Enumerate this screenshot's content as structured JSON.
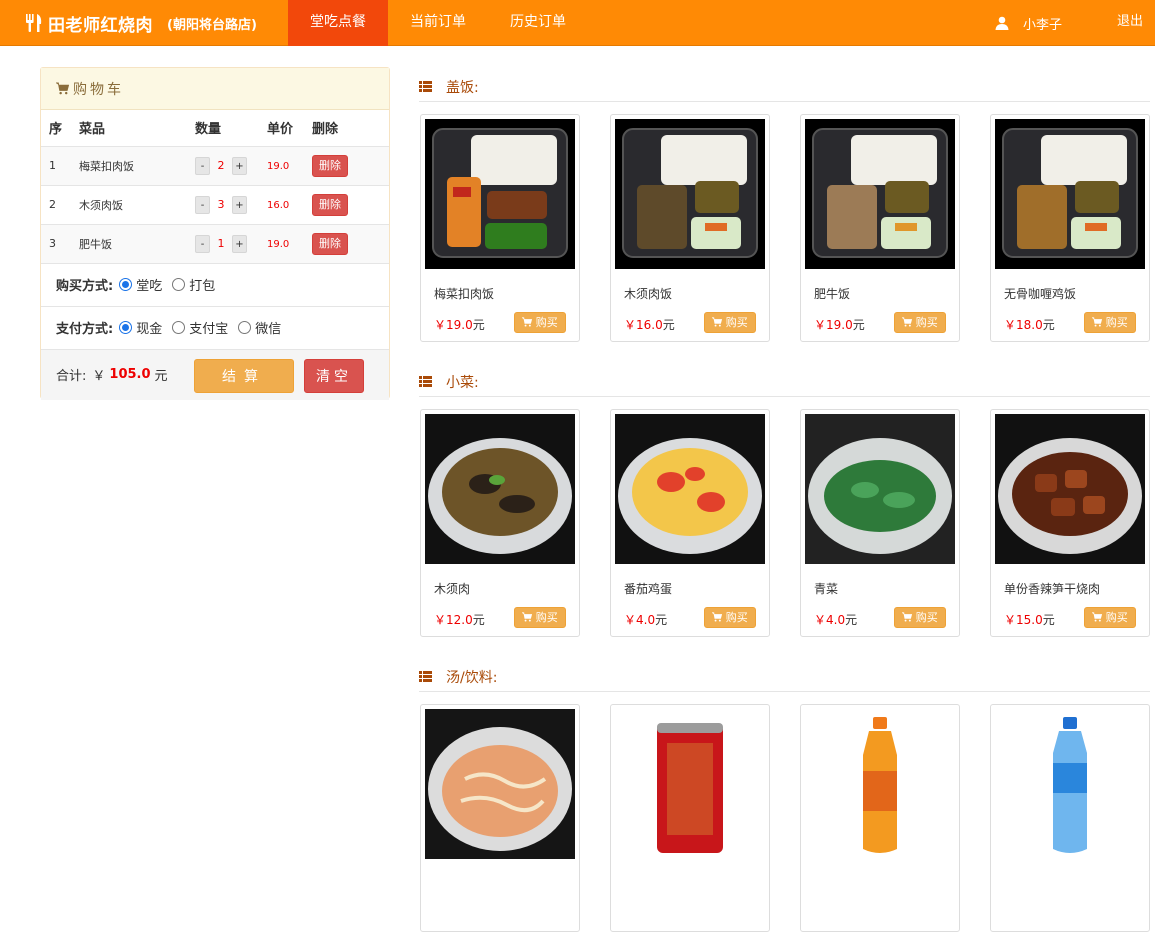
{
  "navbar": {
    "brand": "田老师红烧肉",
    "branch": "(朝阳将台路店)",
    "items": [
      "堂吃点餐",
      "当前订单",
      "历史订单"
    ],
    "user": "小李子",
    "logout": "退出",
    "colors": {
      "bar": "#ff8a05",
      "active": "#f2480b"
    }
  },
  "cart": {
    "title": "购物车",
    "headers": [
      "序",
      "菜品",
      "数量",
      "单价",
      "删除"
    ],
    "rows": [
      {
        "no": "1",
        "name": "梅菜扣肉饭",
        "qty": "2",
        "price": "19.0"
      },
      {
        "no": "2",
        "name": "木须肉饭",
        "qty": "3",
        "price": "16.0"
      },
      {
        "no": "3",
        "name": "肥牛饭",
        "qty": "1",
        "price": "19.0"
      }
    ],
    "minus": "-",
    "plus": "+",
    "delete_label": "删除",
    "purchase_label": "购买方式:",
    "purchase_options": [
      "堂吃",
      "打包"
    ],
    "purchase_selected": "堂吃",
    "payment_label": "支付方式:",
    "payment_options": [
      "现金",
      "支付宝",
      "微信"
    ],
    "payment_selected": "现金",
    "total_label": "合计:",
    "currency": "￥",
    "total": "105.0",
    "unit": "元",
    "checkout": "结算",
    "clear": "清空"
  },
  "menu": {
    "buy_label": "购买",
    "currency": "￥",
    "unit": "元",
    "sections": [
      {
        "title": "盖饭:",
        "items": [
          {
            "name": "梅菜扣肉饭",
            "price": "19.0",
            "image": "meicai-rice-box"
          },
          {
            "name": "木须肉饭",
            "price": "16.0",
            "image": "muxu-rice-box"
          },
          {
            "name": "肥牛饭",
            "price": "19.0",
            "image": "beef-rice-box"
          },
          {
            "name": "无骨咖喱鸡饭",
            "price": "18.0",
            "image": "curry-rice-box"
          }
        ]
      },
      {
        "title": "小菜:",
        "items": [
          {
            "name": "木须肉",
            "price": "12.0",
            "image": "muxu-bowl"
          },
          {
            "name": "番茄鸡蛋",
            "price": "4.0",
            "image": "tomato-egg-bowl"
          },
          {
            "name": "青菜",
            "price": "4.0",
            "image": "greens-bowl"
          },
          {
            "name": "单份香辣笋干烧肉",
            "price": "15.0",
            "image": "pork-bowl"
          }
        ]
      },
      {
        "title": "汤/饮料:",
        "items": [
          {
            "image": "soup-bowl"
          },
          {
            "image": "wanglaoji-can"
          },
          {
            "image": "orange-juice-bottle"
          },
          {
            "image": "water-bottle"
          }
        ]
      }
    ]
  }
}
